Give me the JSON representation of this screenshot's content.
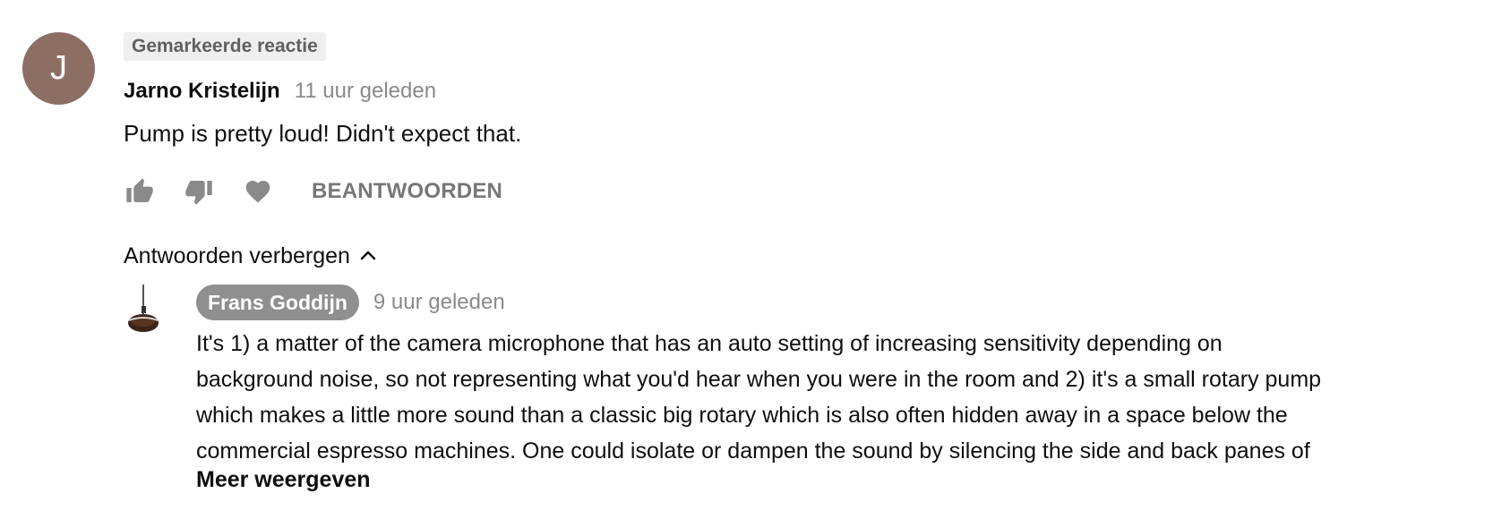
{
  "comment": {
    "avatar_initial": "J",
    "avatar_color": "#8d6e63",
    "badge": "Gemarkeerde reactie",
    "author": "Jarno Kristelijn",
    "time": "11 uur geleden",
    "text": "Pump is pretty loud! Didn't expect that.",
    "actions": {
      "like_icon": "thumb-up-icon",
      "dislike_icon": "thumb-down-icon",
      "heart_icon": "heart-icon",
      "reply_label": "BEANTWOORDEN"
    },
    "hide_replies_label": "Antwoorden verbergen"
  },
  "reply": {
    "author": "Frans Goddijn",
    "time": "9 uur geleden",
    "text_lines": [
      "It's 1) a matter of the camera microphone that has an auto setting of increasing sensitivity depending on",
      "background noise, so not representing what you'd hear when you were in the room and 2) it's a small rotary pump",
      "which makes a little more sound than a classic big rotary which is also often hidden away in a space below the",
      "commercial espresso machines. One could isolate or dampen the sound by silencing the side and back panes of"
    ],
    "more_label": "Meer weergeven",
    "author_badge_color": "#8f8f8f"
  }
}
